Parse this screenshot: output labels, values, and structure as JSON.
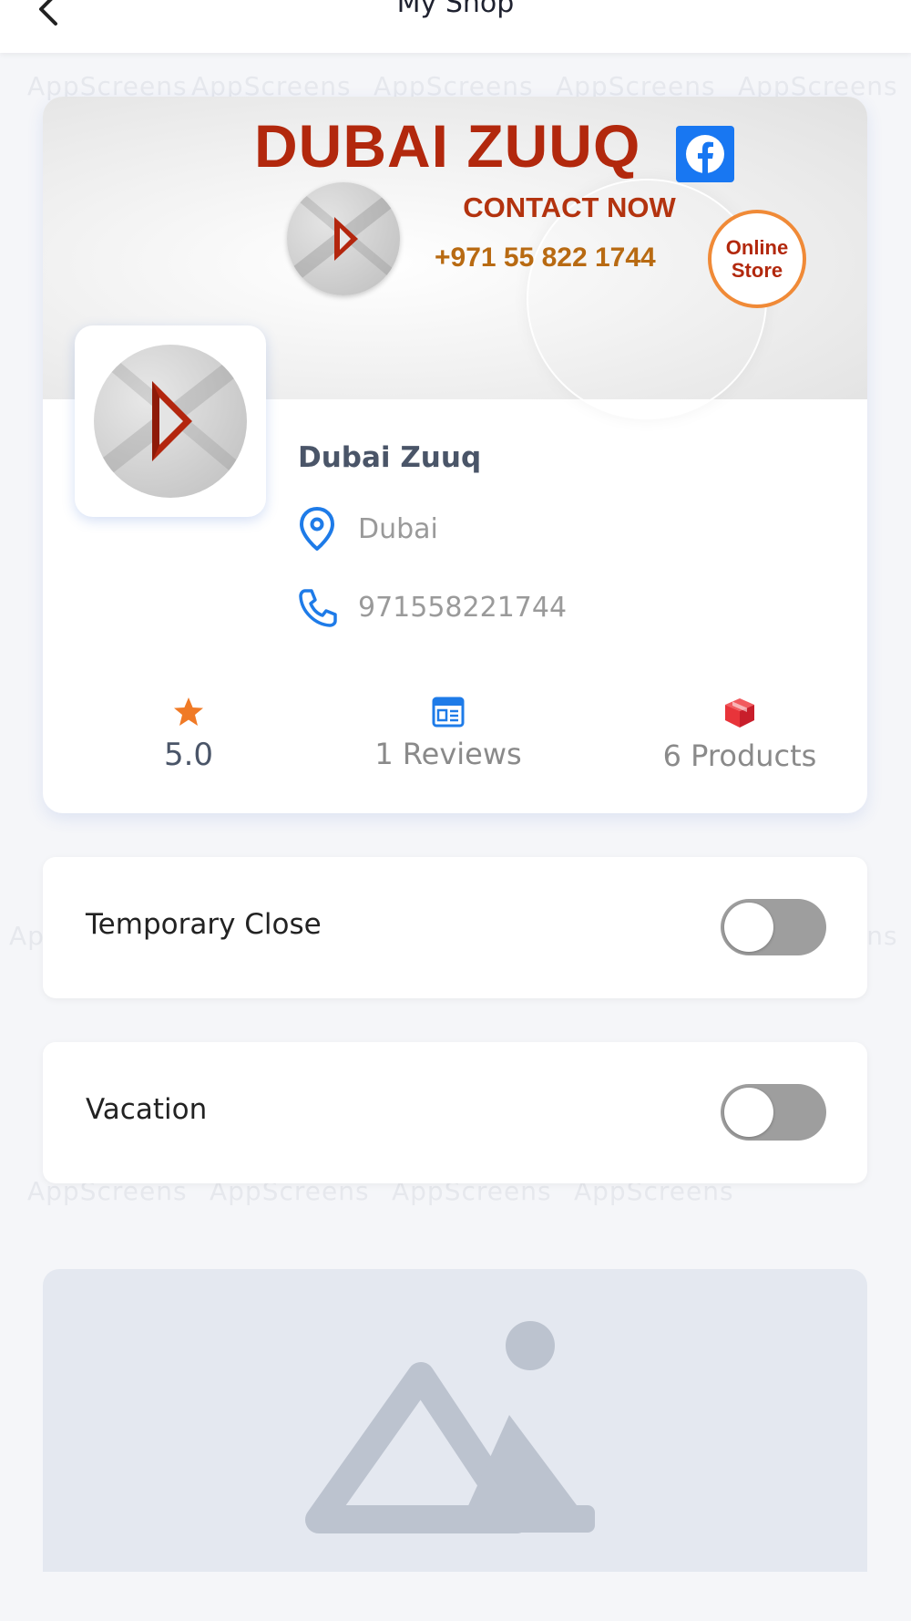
{
  "header": {
    "title": "My Shop",
    "back_icon": "chevron-left-icon"
  },
  "watermark": "AppScreens",
  "banner": {
    "title": "DUBAI ZUUQ",
    "contact_label": "CONTACT NOW",
    "phone": "+971 55 822 1744",
    "badge_line1": "Online",
    "badge_line2": "Store",
    "social_icon": "facebook-icon"
  },
  "shop": {
    "name": "Dubai Zuuq",
    "location": "Dubai",
    "phone": "971558221744",
    "location_icon": "location-pin-icon",
    "phone_icon": "phone-icon"
  },
  "stats": {
    "rating": "5.0",
    "reviews": "1 Reviews",
    "products": "6 Products",
    "rating_icon": "star-icon",
    "reviews_icon": "reviews-icon",
    "products_icon": "box-icon"
  },
  "settings": {
    "temporary_close_label": "Temporary Close",
    "temporary_close_on": false,
    "vacation_label": "Vacation",
    "vacation_on": false
  },
  "colors": {
    "accent_blue": "#1e7be8",
    "star_orange": "#f07a26",
    "products_red": "#e8343a",
    "toggle_off": "#9e9e9e",
    "brand_red": "#b2280d"
  }
}
